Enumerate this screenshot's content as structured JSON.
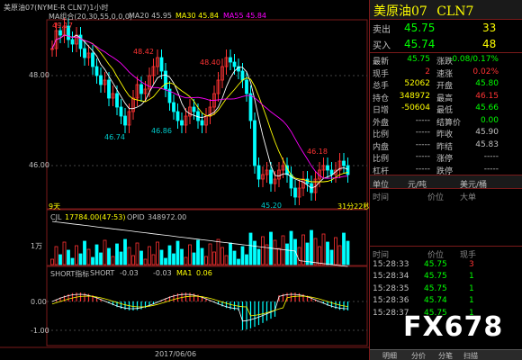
{
  "header": {
    "instrument_title": "美原油07(NYME-R CLN7)1小时",
    "indicators": [
      {
        "label": "MA组合(20,30,55,0,0,0)",
        "color": "#c0c0c0"
      },
      {
        "label": "MA20 45.95",
        "color": "#c0c0c0"
      },
      {
        "label": "MA30 45.84",
        "color": "#ffff00"
      },
      {
        "label": "MA55 45.84",
        "color": "#ff00ff"
      }
    ]
  },
  "main_chart": {
    "y_labels": [
      "48.00",
      "46.00"
    ],
    "annotations": [
      {
        "text": "49.17",
        "color": "#ff3333"
      },
      {
        "text": "48.42",
        "color": "#ff3333"
      },
      {
        "text": "48.40",
        "color": "#ff3333"
      },
      {
        "text": "46.74",
        "color": "#00cccc"
      },
      {
        "text": "46.86",
        "color": "#00cccc"
      },
      {
        "text": "46.18",
        "color": "#ff3333"
      },
      {
        "text": "45.20",
        "color": "#00cccc"
      }
    ],
    "left_footer": "9天",
    "right_footer": "31分22秒"
  },
  "volume_panel": {
    "label": "CJL",
    "value": "17784.00(47:53)",
    "opid_label": "OPID",
    "opid_value": "348972.00",
    "y_label": "1万"
  },
  "osc_panel": {
    "label": "SHORT指标",
    "short_label": "SHORT",
    "short_value": "-0.03",
    "val2": "-0.03",
    "ma1_label": "MA1",
    "ma1_value": "0.06",
    "y_labels": [
      "0.00",
      "-1.00"
    ],
    "date": "2017/06/06"
  },
  "quote": {
    "name": "美原油07",
    "code": "CLN7",
    "sell_label": "卖出",
    "sell_price": "45.75",
    "sell_qty": "33",
    "buy_label": "买入",
    "buy_price": "45.74",
    "buy_qty": "48",
    "stats": [
      {
        "l1": "最新",
        "v1": "45.75",
        "c1": "#00ff00",
        "l2": "涨跌",
        "v2": "-0.08/0.17%",
        "c2": "#00ff00"
      },
      {
        "l1": "现手",
        "v1": "2",
        "c1": "#ff3333",
        "l2": "速涨",
        "v2": "0.02%",
        "c2": "#ff3333"
      },
      {
        "l1": "总手",
        "v1": "52062",
        "c1": "#ffff00",
        "l2": "开盘",
        "v2": "45.80",
        "c2": "#00ff00"
      },
      {
        "l1": "持仓",
        "v1": "348972",
        "c1": "#ffff00",
        "l2": "最高",
        "v2": "46.15",
        "c2": "#ff3333"
      },
      {
        "l1": "日增",
        "v1": "-50604",
        "c1": "#ffff00",
        "l2": "最低",
        "v2": "45.66",
        "c2": "#00ff00"
      },
      {
        "l1": "外盘",
        "v1": "-----",
        "c1": "#c0c0c0",
        "l2": "结算价",
        "v2": "0.00",
        "c2": "#00ff00"
      },
      {
        "l1": "比例",
        "v1": "-----",
        "c1": "#c0c0c0",
        "l2": "昨收",
        "v2": "45.90",
        "c2": "#c0c0c0"
      },
      {
        "l1": "内盘",
        "v1": "-----",
        "c1": "#c0c0c0",
        "l2": "昨结",
        "v2": "45.83",
        "c2": "#c0c0c0"
      },
      {
        "l1": "比例",
        "v1": "-----",
        "c1": "#c0c0c0",
        "l2": "涨停",
        "v2": "-----",
        "c2": "#c0c0c0"
      },
      {
        "l1": "杠杆",
        "v1": "-----",
        "c1": "#c0c0c0",
        "l2": "跌停",
        "v2": "-----",
        "c2": "#c0c0c0"
      }
    ],
    "unit_row": {
      "label": "单位",
      "v1": "元/吨",
      "v2": "美元/桶"
    },
    "detail_headers": {
      "time": "时间",
      "price": "价位",
      "volume": "大单"
    },
    "tick_headers": {
      "time": "时间",
      "price": "价位",
      "volume": "现手"
    },
    "ticks": [
      {
        "time": "15:28:33",
        "price": "45.75",
        "vol": "3"
      },
      {
        "time": "15:28:34",
        "price": "45.75",
        "vol": "1"
      },
      {
        "time": "15:28:35",
        "price": "45.75",
        "vol": "1"
      },
      {
        "time": "15:28:36",
        "price": "45.74",
        "vol": "1"
      },
      {
        "time": "15:28:37",
        "price": "45.75",
        "vol": "1"
      }
    ],
    "tabs": [
      "明细",
      "分价",
      "分笔",
      "扫描"
    ]
  },
  "watermark": "FX678"
}
